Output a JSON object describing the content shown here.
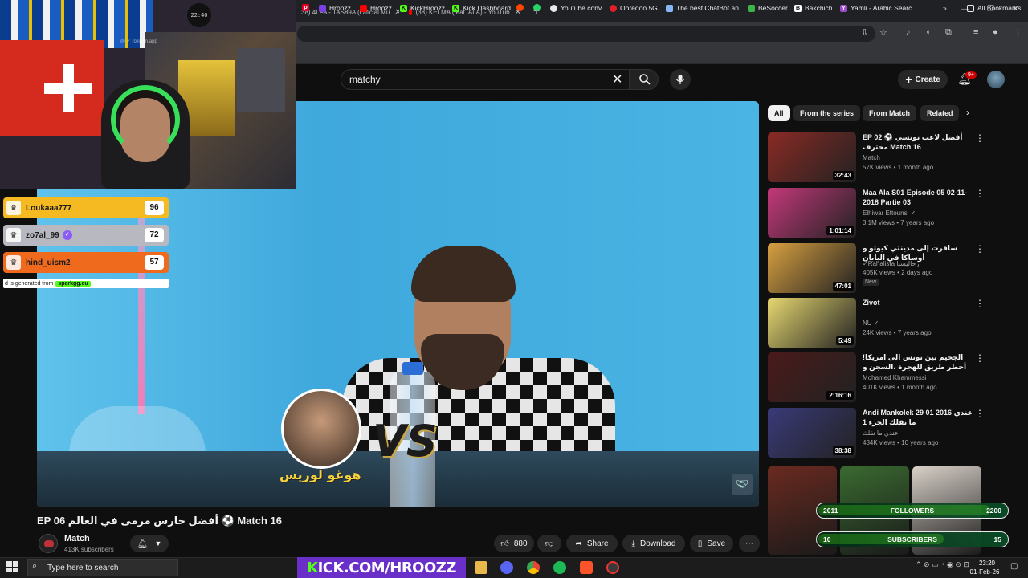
{
  "browser": {
    "tabs": [
      {
        "label": "38) 4LFA - TAS89A (Official Mu"
      },
      {
        "label": "(38) KELMA (feat. ALA) - YouTub"
      }
    ],
    "new_tab": "+",
    "bookmarks": [
      {
        "label": "Hroozz",
        "color": "#7b3fe4"
      },
      {
        "label": "Hroozz",
        "color": "#ff0000"
      },
      {
        "label": "KickHroozz",
        "color": "#53fc18"
      },
      {
        "label": "Kick Dashboard",
        "color": "#53fc18"
      },
      {
        "label": "Youtube conv",
        "color": "#e8e8e8"
      },
      {
        "label": "Ooredoo 5G",
        "color": "#e41e26"
      },
      {
        "label": "The best ChatBot an...",
        "color": "#e8e8e8"
      },
      {
        "label": "BeSoccer",
        "color": "#3bb54a"
      },
      {
        "label": "Bakchich",
        "color": "#ffffff"
      },
      {
        "label": "Yamli - Arabic Searc...",
        "color": "#9b4dca"
      }
    ],
    "all_bookmarks": "All Bookmarks"
  },
  "youtube": {
    "search_value": "matchy",
    "create_label": "Create",
    "notification_count": "9+"
  },
  "video": {
    "caption_overlay": "هوغو لوريس",
    "vs_label": "VS",
    "title": "EP 06 أفضل حارس مرمى في العالم ⚽️ Match 16",
    "channel": "Match",
    "subscribers": "413K subscribers",
    "likes": "880",
    "share_label": "Share",
    "download_label": "Download",
    "save_label": "Save"
  },
  "chips": [
    {
      "label": "All",
      "active": true
    },
    {
      "label": "From the series",
      "active": false
    },
    {
      "label": "From Match",
      "active": false
    },
    {
      "label": "Related",
      "active": false
    }
  ],
  "recommendations": [
    {
      "title": "EP 02 ⚽️ أفضل لاعب تونسي محترف Match 16",
      "channel": "Match",
      "meta": "57K views • 1 month ago",
      "duration": "32:43",
      "thumb": "#8a2a24",
      "new": ""
    },
    {
      "title": "Maa Ala S01 Episode 05 02-11-2018 Partie 03",
      "channel": "Elhiwar Ettounsi ✓",
      "meta": "3.1M views • 7 years ago",
      "duration": "1:01:14",
      "thumb": "#c4387a",
      "new": ""
    },
    {
      "title": "سافرت إلى مدينتي كيوتو و أوساكا في اليابان",
      "channel": "✓Rahalista رحاليستا",
      "meta": "405K views • 2 days ago",
      "duration": "47:01",
      "thumb": "#d8a040",
      "new": "New"
    },
    {
      "title": "Zivot",
      "channel": "NU ✓",
      "meta": "24K views • 7 years ago",
      "duration": "5:49",
      "thumb": "#e8d870",
      "new": ""
    },
    {
      "title": "الجحيم بين تونس الى امريكا! أخطر طريق للهجرة ،السجن و الاختطاف في المكسيك من ...",
      "channel": "Mohamed Khammessi",
      "meta": "401K views • 1 month ago",
      "duration": "2:16:16",
      "thumb": "#4a1a1a",
      "new": ""
    },
    {
      "title": "Andi Mankolek 29 01 2016 عندي ما نقلك الجزء 1",
      "channel": "عندي ما نقلك",
      "meta": "434K views • 10 years ago",
      "duration": "38:38",
      "thumb": "#3a3a7a",
      "new": ""
    }
  ],
  "shorts": [
    {
      "color": "#6a2a20"
    },
    {
      "color": "#3a6a30"
    },
    {
      "color": "#d8d0c8"
    }
  ],
  "overlay": {
    "clock": "22:40",
    "watermark": "@ ✓ rolloom.app",
    "leaderboard": [
      {
        "name": "Loukaaa777",
        "score": "96",
        "color": "#f5b921",
        "verified": false
      },
      {
        "name": "zo7al_99",
        "score": "72",
        "color": "#b8b8c0",
        "verified": true
      },
      {
        "name": "hind_uism2",
        "score": "57",
        "color": "#f06a1e",
        "verified": false
      }
    ],
    "leaderboard_footer": "d is generated from",
    "leaderboard_brand": "sparkgg.eu",
    "followers": {
      "left": "2011",
      "label": "FOLLOWERS",
      "right": "2200",
      "progress": 0.914
    },
    "subscribers": {
      "left": "10",
      "label": "SUBSCRIBERS",
      "right": "15",
      "progress": 0.667
    }
  },
  "taskbar": {
    "search_placeholder": "Type here to search",
    "kick_banner_k": "K",
    "kick_banner_rest": "ICK.COM/HROOZZ",
    "time": "23:20",
    "date": "01-Feb-26"
  }
}
